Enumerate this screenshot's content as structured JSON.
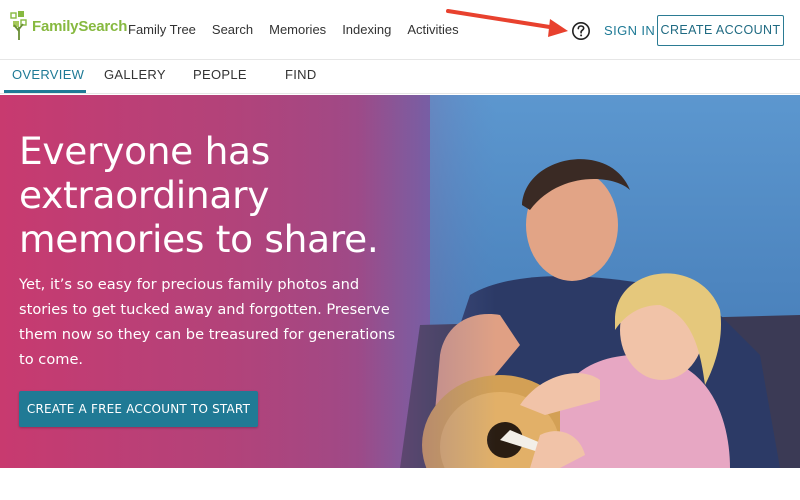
{
  "brand": {
    "name": "FamilySearch"
  },
  "nav": {
    "items": [
      "Family Tree",
      "Search",
      "Memories",
      "Indexing",
      "Activities"
    ],
    "sign_in": "SIGN IN",
    "create_account": "CREATE ACCOUNT",
    "help_icon": "question-circle-icon"
  },
  "subtabs": {
    "items": [
      "OVERVIEW",
      "GALLERY",
      "PEOPLE",
      "FIND"
    ],
    "active": "OVERVIEW"
  },
  "hero": {
    "title": "Everyone has extraordinary memories to share.",
    "title_lines": [
      "Everyone has",
      "extraordinary",
      "memories to share."
    ],
    "body": "Yet, it’s so easy for precious family photos and stories to get tucked away and forgotten. Preserve them now so they can be treasured for generations to come.",
    "cta": "CREATE A FREE ACCOUNT TO START"
  },
  "colors": {
    "brand_green": "#87b940",
    "accent_teal": "#1f7a96",
    "cta_bg": "#207a95",
    "annotation_arrow": "#e8412e"
  }
}
